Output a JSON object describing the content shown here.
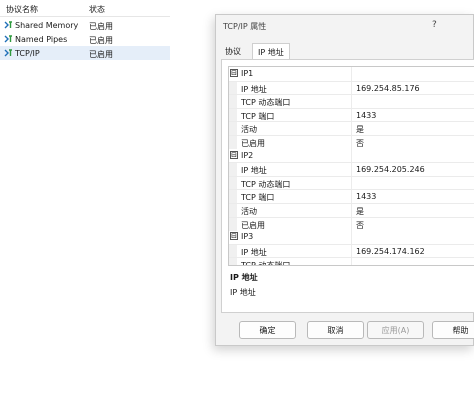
{
  "list": {
    "headers": {
      "name": "协议名称",
      "state": "状态"
    },
    "rows": [
      {
        "name": "Shared Memory",
        "state": "已启用",
        "icon": "protocol-icon"
      },
      {
        "name": "Named Pipes",
        "state": "已启用",
        "icon": "protocol-icon"
      },
      {
        "name": "TCP/IP",
        "state": "已启用",
        "icon": "protocol-icon",
        "selected": true
      }
    ]
  },
  "dialog": {
    "title": "TCP/IP 属性",
    "help_glyph": "?",
    "tabs": [
      {
        "label": "协议"
      },
      {
        "label": "IP 地址",
        "active": true
      }
    ],
    "groups": [
      {
        "name": "IP1",
        "expander": "⊟",
        "props": [
          {
            "key": "IP 地址",
            "value": "169.254.85.176"
          },
          {
            "key": "TCP 动态端口",
            "value": ""
          },
          {
            "key": "TCP 端口",
            "value": "1433"
          },
          {
            "key": "活动",
            "value": "是"
          },
          {
            "key": "已启用",
            "value": "否"
          }
        ]
      },
      {
        "name": "IP2",
        "expander": "⊟",
        "props": [
          {
            "key": "IP 地址",
            "value": "169.254.205.246"
          },
          {
            "key": "TCP 动态端口",
            "value": ""
          },
          {
            "key": "TCP 端口",
            "value": "1433"
          },
          {
            "key": "活动",
            "value": "是"
          },
          {
            "key": "已启用",
            "value": "否"
          }
        ]
      },
      {
        "name": "IP3",
        "expander": "⊟",
        "props": [
          {
            "key": "IP 地址",
            "value": "169.254.174.162"
          },
          {
            "key": "TCP 动态端口",
            "value": ""
          }
        ]
      }
    ],
    "description": {
      "title": "IP 地址",
      "text": "IP 地址"
    },
    "buttons": {
      "ok": "确定",
      "cancel": "取消",
      "apply": "应用(A)",
      "help": "帮助"
    }
  }
}
